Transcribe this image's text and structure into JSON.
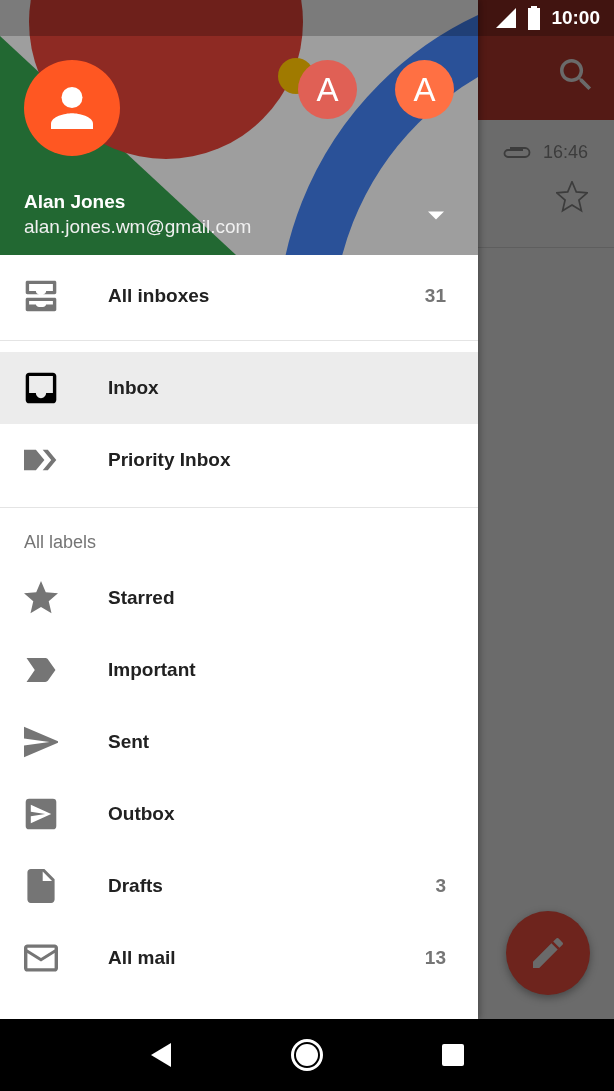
{
  "status_bar": {
    "time": "10:00"
  },
  "account": {
    "name": "Alan Jones",
    "email": "alan.jones.wm@gmail.com",
    "other_accounts": [
      {
        "initial": "A",
        "color": "#e06055"
      },
      {
        "initial": "A",
        "color": "#ff7043"
      }
    ]
  },
  "primary_items": [
    {
      "kind": "all-inboxes",
      "label": "All inboxes",
      "count": "31",
      "selected": false
    }
  ],
  "mailbox_items": [
    {
      "kind": "inbox",
      "label": "Inbox",
      "selected": true
    },
    {
      "kind": "priority",
      "label": "Priority Inbox",
      "selected": false
    }
  ],
  "labels": {
    "heading": "All labels",
    "items": [
      {
        "kind": "star",
        "label": "Starred",
        "selected": false
      },
      {
        "kind": "important",
        "label": "Important",
        "selected": false
      },
      {
        "kind": "send",
        "label": "Sent",
        "selected": false
      },
      {
        "kind": "outbox",
        "label": "Outbox",
        "selected": false
      },
      {
        "kind": "draft",
        "label": "Drafts",
        "count": "3",
        "selected": false
      },
      {
        "kind": "all-mail",
        "label": "All mail",
        "count": "13",
        "selected": false
      }
    ]
  },
  "background_message": {
    "time": "16:46",
    "has_attachment": true,
    "starred": false
  }
}
